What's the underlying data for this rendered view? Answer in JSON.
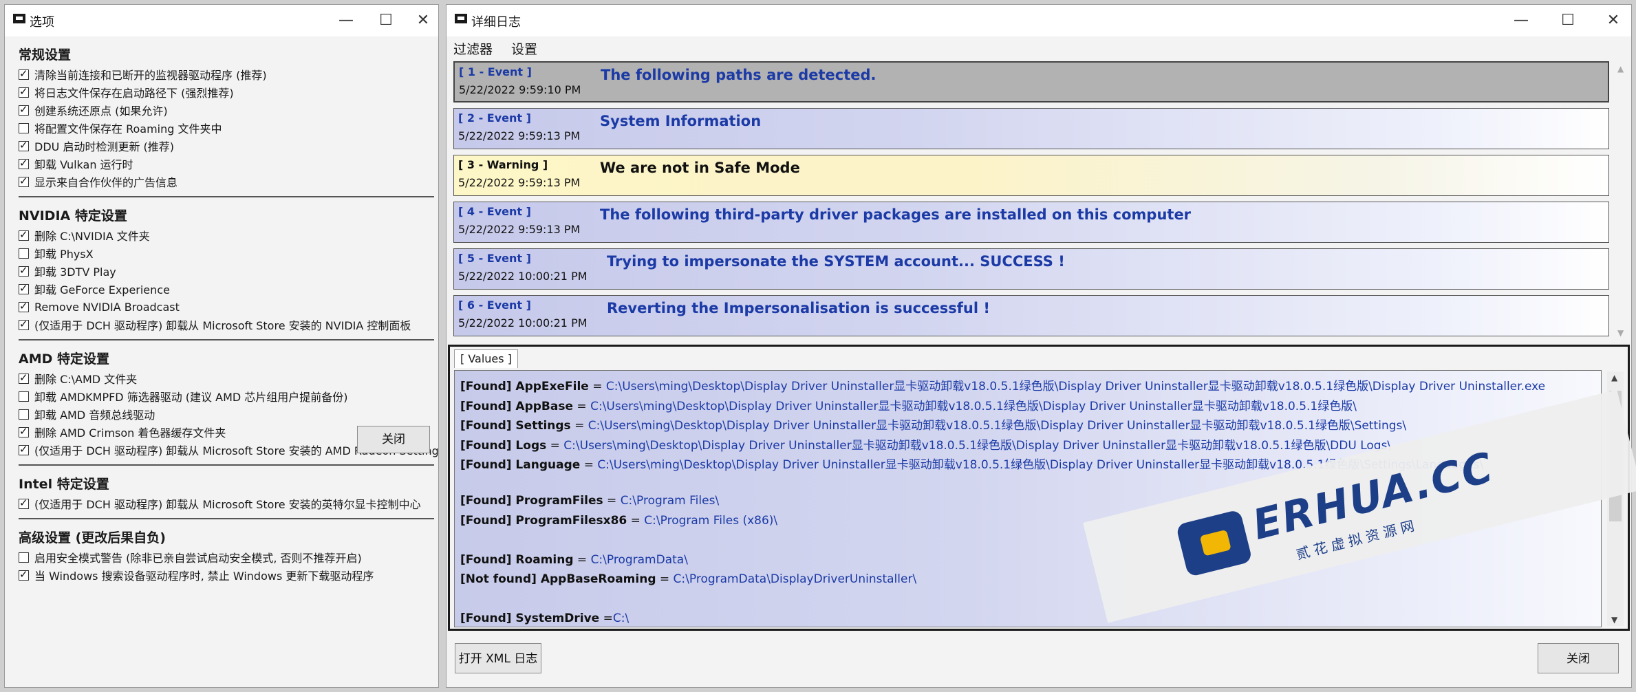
{
  "options_window": {
    "title": "选项",
    "sections": [
      {
        "title": "常规设置",
        "items": [
          {
            "label": "清除当前连接和已断开的监视器驱动程序 (推荐)",
            "checked": true
          },
          {
            "label": "将日志文件保存在启动路径下 (强烈推荐)",
            "checked": true
          },
          {
            "label": "创建系统还原点 (如果允许)",
            "checked": true
          },
          {
            "label": "将配置文件保存在 Roaming 文件夹中",
            "checked": false
          },
          {
            "label": "DDU 启动时检测更新 (推荐)",
            "checked": true
          },
          {
            "label": "卸载 Vulkan 运行时",
            "checked": true
          },
          {
            "label": "显示来自合作伙伴的广告信息",
            "checked": true
          }
        ]
      },
      {
        "title": "NVIDIA 特定设置",
        "items": [
          {
            "label": "删除 C:\\NVIDIA 文件夹",
            "checked": true
          },
          {
            "label": "卸载 PhysX",
            "checked": false
          },
          {
            "label": "卸载 3DTV Play",
            "checked": true
          },
          {
            "label": "卸载 GeForce Experience",
            "checked": true
          },
          {
            "label": "Remove NVIDIA Broadcast",
            "checked": true
          },
          {
            "label": "(仅适用于 DCH 驱动程序) 卸载从 Microsoft Store 安装的 NVIDIA 控制面板",
            "checked": true
          }
        ]
      },
      {
        "title": "AMD 特定设置",
        "items": [
          {
            "label": "删除 C:\\AMD 文件夹",
            "checked": true
          },
          {
            "label": "卸载 AMDKMPFD 筛选器驱动 (建议 AMD 芯片组用户提前备份)",
            "checked": false
          },
          {
            "label": "卸载 AMD 音频总线驱动",
            "checked": false
          },
          {
            "label": "删除 AMD Crimson 着色器缓存文件夹",
            "checked": true
          },
          {
            "label": "(仅适用于 DCH 驱动程序) 卸载从 Microsoft Store 安装的 AMD Radeon Settings",
            "checked": true
          }
        ]
      },
      {
        "title": "Intel 特定设置",
        "items": [
          {
            "label": "(仅适用于 DCH 驱动程序) 卸载从 Microsoft Store 安装的英特尔显卡控制中心",
            "checked": true
          }
        ]
      },
      {
        "title": "高级设置 (更改后果自负)",
        "items": [
          {
            "label": "启用安全模式警告 (除非已亲自尝试启动安全模式, 否则不推荐开启)",
            "checked": false
          },
          {
            "label": "当 Windows 搜索设备驱动程序时, 禁止 Windows 更新下载驱动程序",
            "checked": true
          }
        ]
      }
    ],
    "close_button": "关闭"
  },
  "log_window": {
    "title": "详细日志",
    "menu": [
      "过滤器",
      "设置"
    ],
    "events": [
      {
        "type": "[ 1 - Event ]",
        "time": "5/22/2022 9:59:10 PM",
        "message": "The following paths are detected.",
        "style": "selected"
      },
      {
        "type": "[ 2 - Event ]",
        "time": "5/22/2022 9:59:13 PM",
        "message": "System Information",
        "style": "event"
      },
      {
        "type": "[ 3 - Warning ]",
        "time": "5/22/2022 9:59:13 PM",
        "message": "We are not in Safe Mode",
        "style": "warning"
      },
      {
        "type": "[ 4 - Event ]",
        "time": "5/22/2022 9:59:13 PM",
        "message": "The following third-party driver packages are installed on this computer",
        "style": "event"
      },
      {
        "type": "[ 5 - Event ]",
        "time": "5/22/2022 10:00:21 PM",
        "message": "Trying to impersonate the SYSTEM account... SUCCESS !",
        "style": "event"
      },
      {
        "type": "[ 6 - Event ]",
        "time": "5/22/2022 10:00:21 PM",
        "message": "Reverting the Impersonalisation is successful !",
        "style": "event"
      }
    ],
    "values_tab": "[ Values ]",
    "values": [
      {
        "key": "[Found] AppExeFile",
        "sep": " = ",
        "value": "C:\\Users\\ming\\Desktop\\Display Driver Uninstaller显卡驱动卸载v18.0.5.1绿色版\\Display Driver Uninstaller显卡驱动卸载v18.0.5.1绿色版\\Display Driver Uninstaller.exe"
      },
      {
        "key": "[Found] AppBase",
        "sep": " = ",
        "value": "C:\\Users\\ming\\Desktop\\Display Driver Uninstaller显卡驱动卸载v18.0.5.1绿色版\\Display Driver Uninstaller显卡驱动卸载v18.0.5.1绿色版\\"
      },
      {
        "key": "[Found] Settings",
        "sep": " = ",
        "value": "C:\\Users\\ming\\Desktop\\Display Driver Uninstaller显卡驱动卸载v18.0.5.1绿色版\\Display Driver Uninstaller显卡驱动卸载v18.0.5.1绿色版\\Settings\\"
      },
      {
        "key": "[Found] Logs",
        "sep": " = ",
        "value": "C:\\Users\\ming\\Desktop\\Display Driver Uninstaller显卡驱动卸载v18.0.5.1绿色版\\Display Driver Uninstaller显卡驱动卸载v18.0.5.1绿色版\\DDU Logs\\"
      },
      {
        "key": "[Found] Language",
        "sep": " = ",
        "value": "C:\\Users\\ming\\Desktop\\Display Driver Uninstaller显卡驱动卸载v18.0.5.1绿色版\\Display Driver Uninstaller显卡驱动卸载v18.0.5.1绿色版\\Settings\\Languages\\"
      },
      {
        "key": "",
        "sep": "",
        "value": ""
      },
      {
        "key": "[Found] ProgramFiles",
        "sep": " = ",
        "value": "C:\\Program Files\\"
      },
      {
        "key": "[Found] ProgramFilesx86",
        "sep": " = ",
        "value": "C:\\Program Files (x86)\\"
      },
      {
        "key": "",
        "sep": "",
        "value": ""
      },
      {
        "key": "[Found] Roaming",
        "sep": " = ",
        "value": "C:\\ProgramData\\"
      },
      {
        "key": "[Not found] AppBaseRoaming",
        "sep": " = ",
        "value": "C:\\ProgramData\\DisplayDriverUninstaller\\"
      },
      {
        "key": "",
        "sep": "",
        "value": ""
      },
      {
        "key": "[Found] SystemDrive",
        "sep": " =",
        "value": "C:\\"
      }
    ],
    "open_xml_button": "打开 XML 日志",
    "close_button": "关闭"
  },
  "watermark": {
    "brand_main": "ERHUA",
    "brand_suffix": ".CC",
    "subtitle": "贰花虚拟资源网"
  },
  "colors": {
    "event_blue": "#1b3aa6",
    "warning_yellow": "#fdf6c6",
    "selected_gray": "#b2b2b2",
    "brand_navy": "#1d3f88",
    "brand_yellow": "#f2b705"
  }
}
